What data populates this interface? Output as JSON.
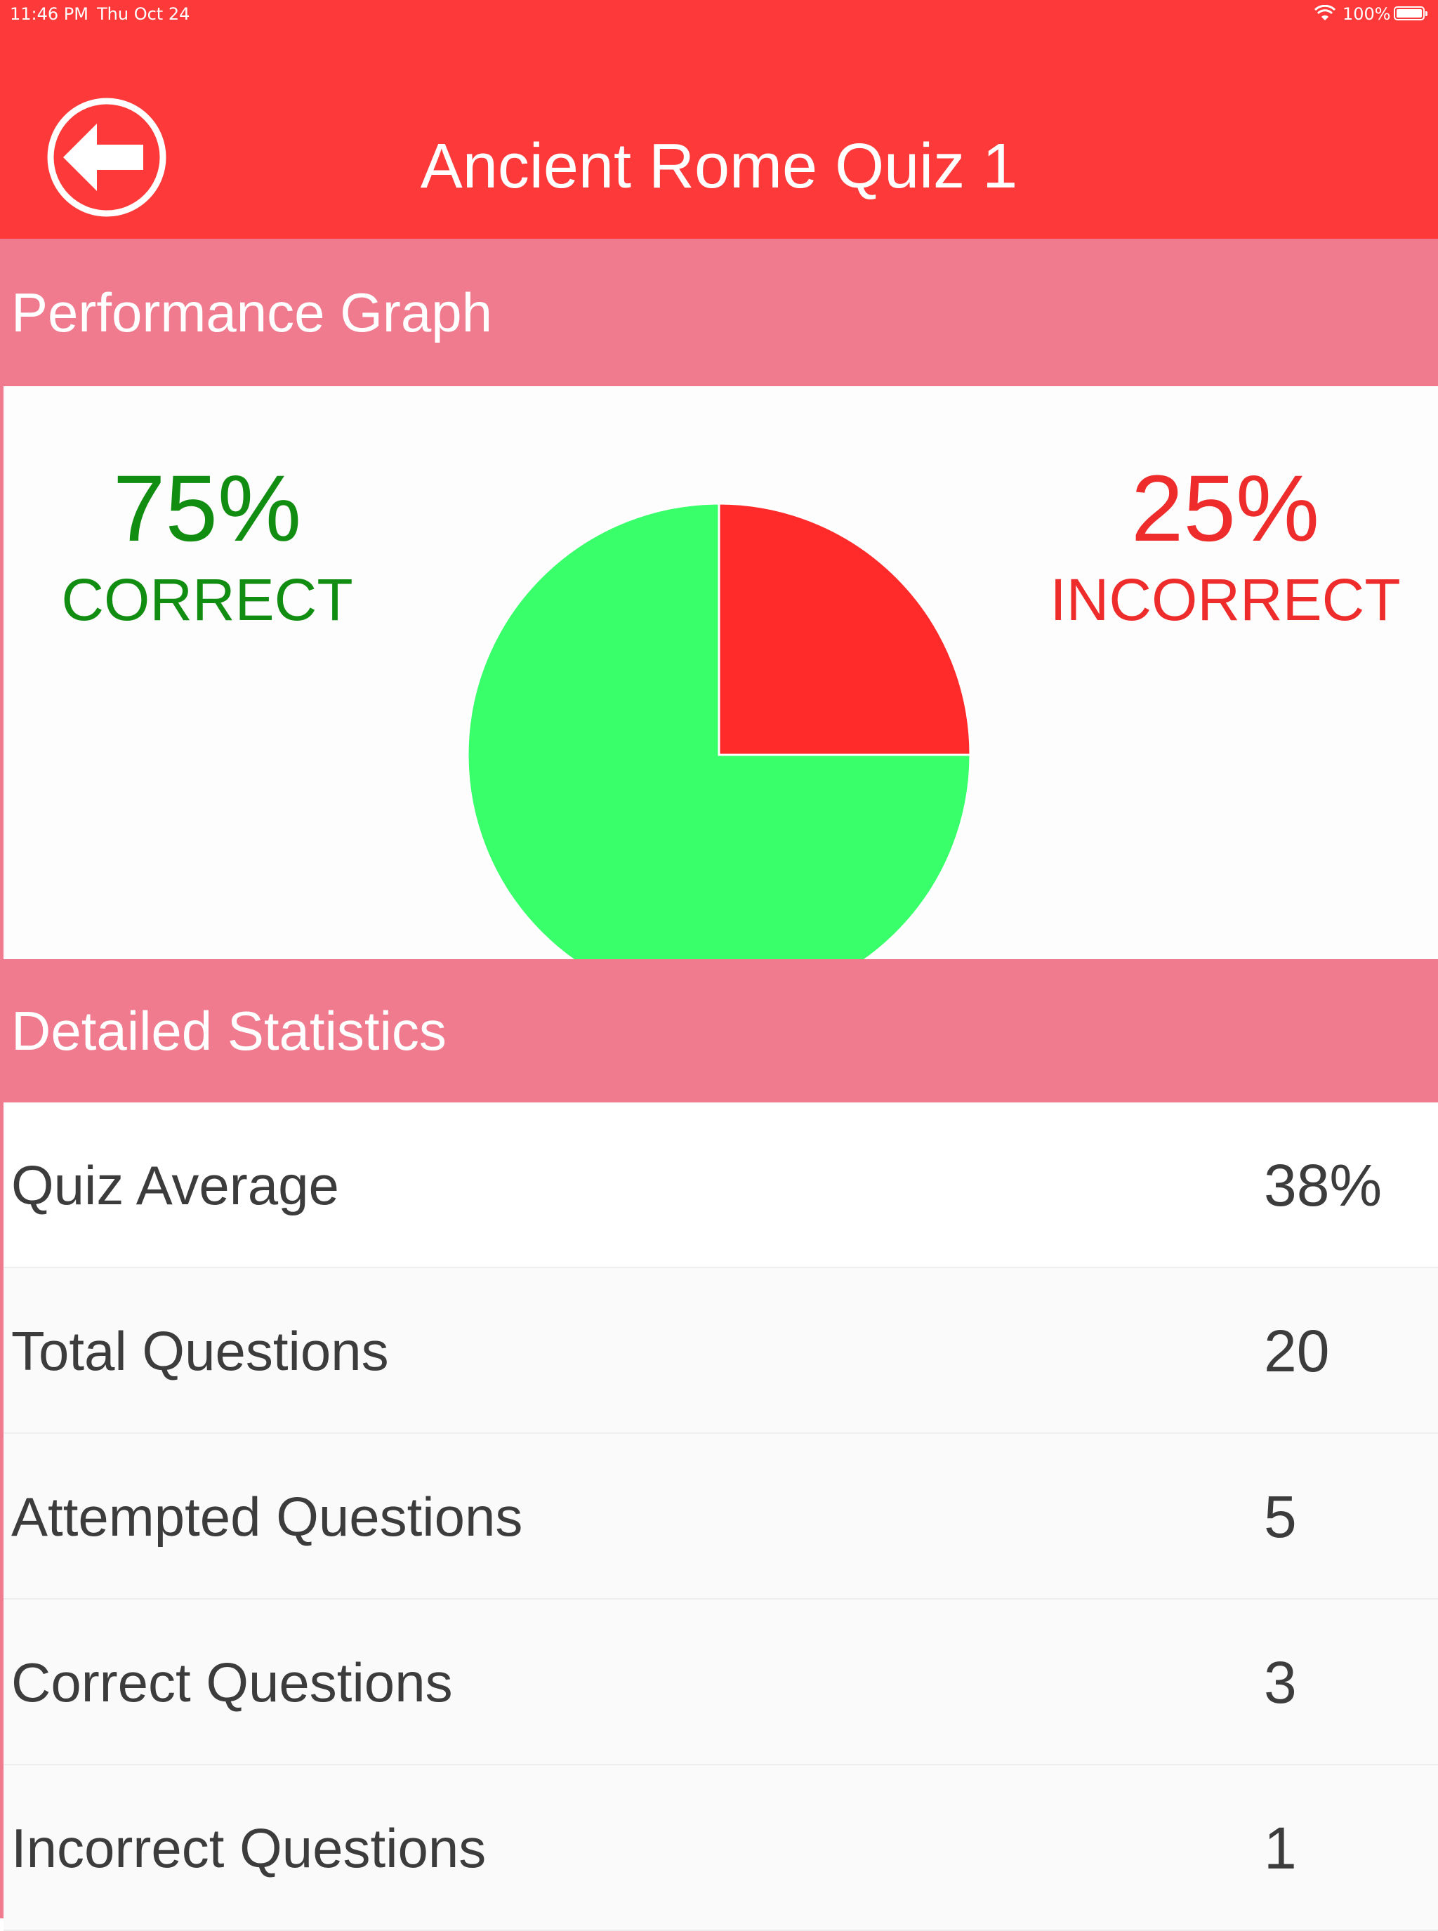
{
  "status_bar": {
    "time": "11:46 PM",
    "date": "Thu Oct 24",
    "battery": "100%"
  },
  "nav": {
    "title": "Ancient Rome Quiz 1",
    "back_icon": "arrow-left-circle-icon"
  },
  "performance": {
    "header": "Performance Graph",
    "correct_pct": "75%",
    "correct_label": "CORRECT",
    "incorrect_pct": "25%",
    "incorrect_label": "INCORRECT"
  },
  "chart_data": {
    "type": "pie",
    "categories": [
      "CORRECT",
      "INCORRECT"
    ],
    "values": [
      75,
      25
    ],
    "colors": [
      "#38ff6a",
      "#ff2a2a"
    ]
  },
  "stats": {
    "header": "Detailed Statistics",
    "rows": [
      {
        "label": "Quiz Average",
        "value": "38%"
      },
      {
        "label": "Total Questions",
        "value": "20"
      },
      {
        "label": "Attempted Questions",
        "value": "5"
      },
      {
        "label": "Correct Questions",
        "value": "3"
      },
      {
        "label": "Incorrect Questions",
        "value": "1"
      }
    ]
  },
  "colors": {
    "nav_red": "#fd3939",
    "section_pink": "#f07b8f",
    "correct_green": "#118d11",
    "incorrect_red": "#ee2c2c"
  }
}
